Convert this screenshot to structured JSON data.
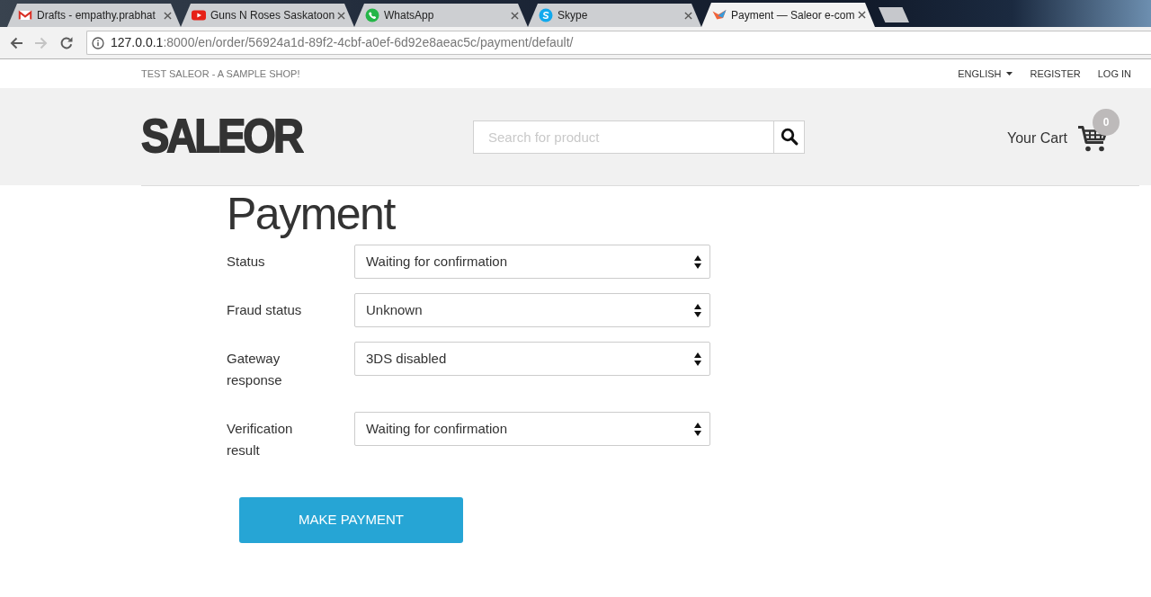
{
  "browser": {
    "tabs": [
      {
        "kind": "mail",
        "title": "Drafts - empathy.prabhat",
        "selected": false
      },
      {
        "kind": "video",
        "title": "Guns N Roses Saskatoon",
        "selected": false
      },
      {
        "kind": "chat",
        "title": "WhatsApp",
        "selected": false
      },
      {
        "kind": "call",
        "title": "Skype",
        "selected": false
      },
      {
        "kind": "shop",
        "title": "Payment — Saleor e-com",
        "selected": true
      }
    ],
    "nav_buttons": [
      {
        "kind": "back",
        "disabled": false
      },
      {
        "kind": "forward",
        "disabled": true
      },
      {
        "kind": "reload",
        "disabled": false
      }
    ],
    "address": {
      "host": "127.0.0.1",
      "path": ":8000/en/order/56924a1d-89f2-4cbf-a0ef-6d92e8aeac5c/payment/default/"
    }
  },
  "top_bar": {
    "tagline": "TEST SALEOR - A SAMPLE SHOP!",
    "links": [
      {
        "kind": "dropdown",
        "label": "ENGLISH"
      },
      {
        "kind": "link",
        "label": "REGISTER"
      },
      {
        "kind": "link",
        "label": "LOG IN"
      }
    ]
  },
  "header": {
    "logo": "SALEOR",
    "search": {
      "placeholder": "Search for product"
    },
    "cart": {
      "label": "Your Cart",
      "count": "0"
    }
  },
  "payment": {
    "title": "Payment",
    "fields": [
      {
        "label": "Status",
        "value": "Waiting for confirmation"
      },
      {
        "label": "Fraud status",
        "value": "Unknown"
      },
      {
        "label": "Gateway response",
        "value": "3DS disabled"
      },
      {
        "label": "Verification result",
        "value": "Waiting for confirmation"
      }
    ],
    "submit": "MAKE PAYMENT"
  }
}
